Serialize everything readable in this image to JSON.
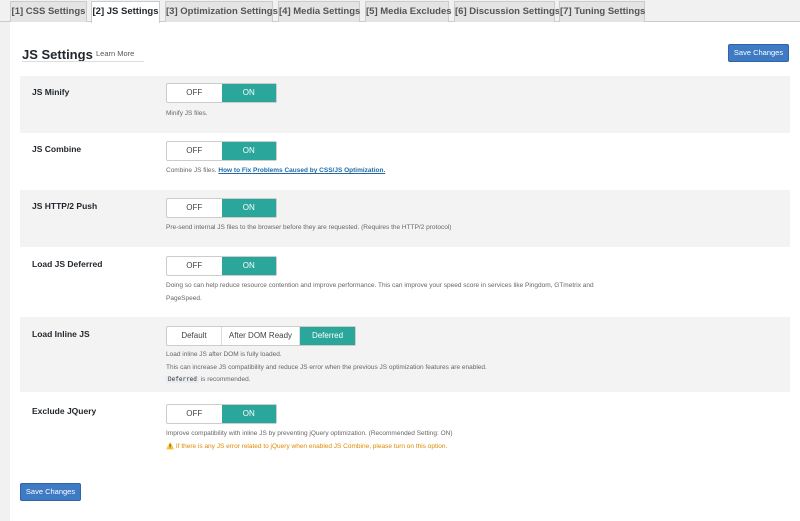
{
  "tabs": [
    {
      "label": "[1] CSS Settings",
      "active": false
    },
    {
      "label": "[2] JS Settings",
      "active": true
    },
    {
      "label": "[3] Optimization Settings",
      "active": false
    },
    {
      "label": "[4] Media Settings",
      "active": false
    },
    {
      "label": "[5] Media Excludes",
      "active": false
    },
    {
      "label": "[6] Discussion Settings",
      "active": false
    },
    {
      "label": "[7] Tuning Settings",
      "active": false
    }
  ],
  "header": {
    "title": "JS Settings",
    "learn_more": "Learn More",
    "save_label": "Save Changes"
  },
  "toggle": {
    "off": "OFF",
    "on": "ON"
  },
  "settings": [
    {
      "label": "JS Minify",
      "state": "ON",
      "desc": "Minify JS files."
    },
    {
      "label": "JS Combine",
      "state": "ON",
      "desc": "Combine JS files.",
      "link": "How to Fix Problems Caused by CSS/JS Optimization."
    },
    {
      "label": "JS HTTP/2 Push",
      "state": "ON",
      "desc": "Pre-send internal JS files to the browser before they are requested. (Requires the HTTP/2 protocol)"
    },
    {
      "label": "Load JS Deferred",
      "state": "ON",
      "desc": "Doing so can help reduce resource contention and improve performance. This can improve your speed score in services like Pingdom, GTmetrix and",
      "desc2": "PageSpeed."
    },
    {
      "label": "Load Inline JS",
      "options": [
        "Default",
        "After DOM Ready",
        "Deferred"
      ],
      "selected": "Deferred",
      "desc": "Load inline JS after DOM is fully loaded.",
      "desc2": "This can increase JS compatibility and reduce JS error when the previous JS optimization features are enabled.",
      "code": "Deferred",
      "desc3": "is recommended."
    },
    {
      "label": "Exclude JQuery",
      "state": "ON",
      "desc": "Improve compatibility with inline JS by preventing jQuery optimization. (Recommended Setting: ON)",
      "warn_icon": "⚠️",
      "warn": "If there is any JS error related to jQuery when enabled JS Combine, please turn on this option."
    }
  ],
  "footer": {
    "save_label": "Save Changes"
  },
  "colors": {
    "accent": "#2aa69a",
    "button": "#3f7bc4",
    "warning": "#e08a00"
  }
}
